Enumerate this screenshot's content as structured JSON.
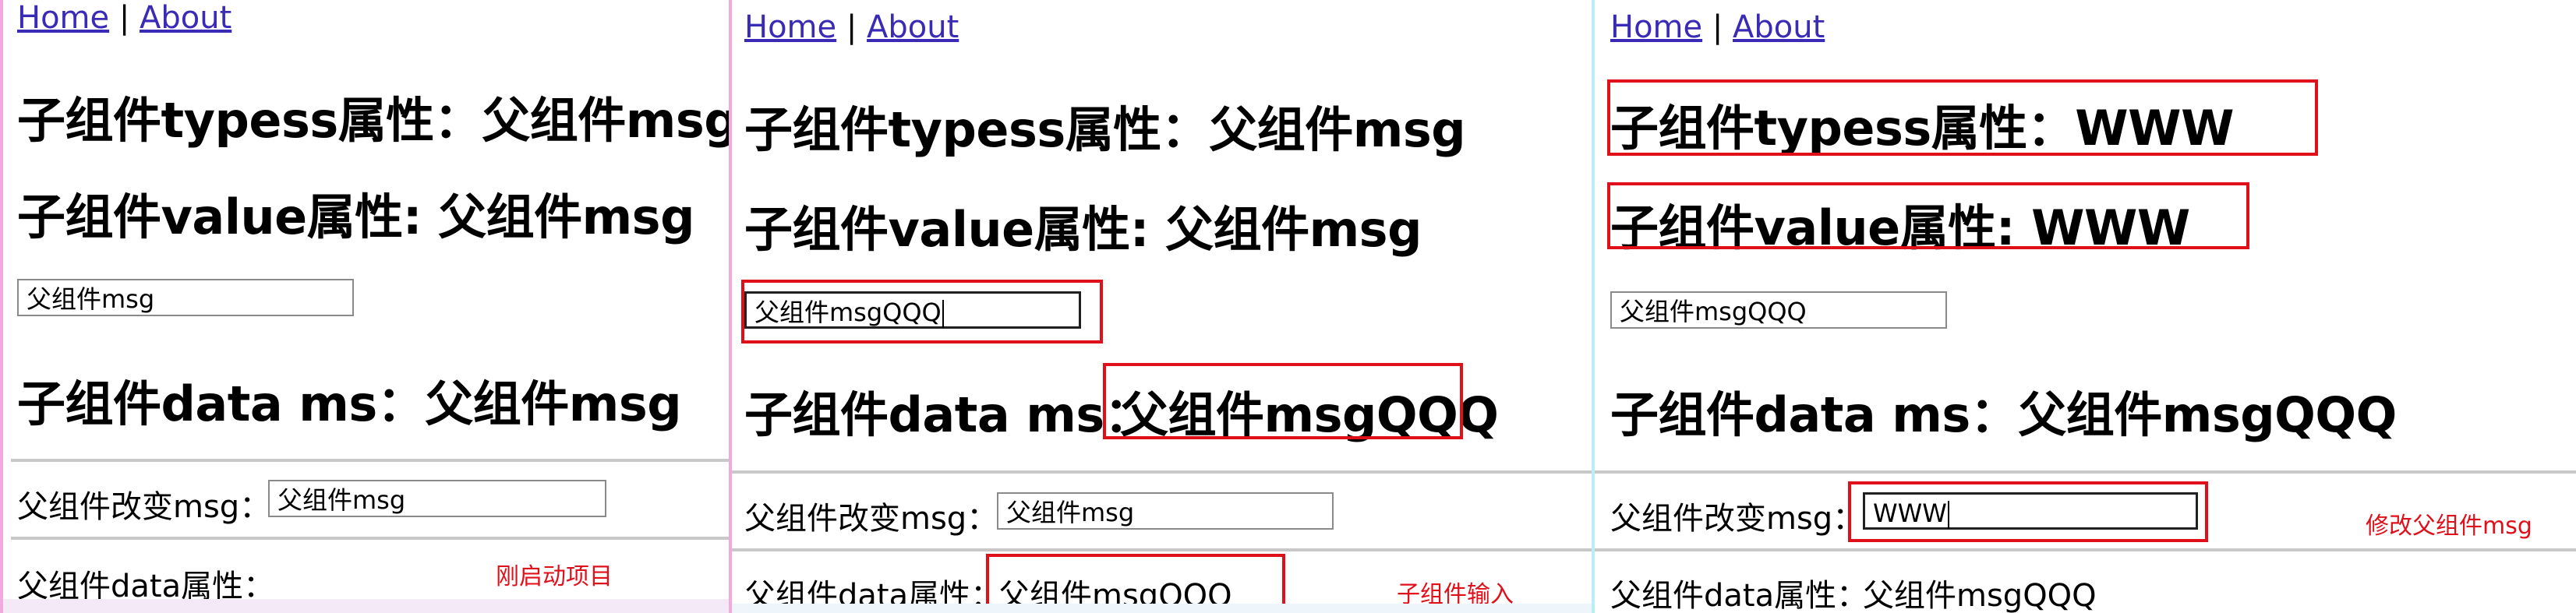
{
  "nav": {
    "home": "Home",
    "sep": "|",
    "about": "About"
  },
  "panels": [
    {
      "typess_line": "子组件typess属性：父组件msg",
      "value_line": "子组件value属性: 父组件msg",
      "child_input_value": "父组件msg",
      "data_ms_line": "子组件data ms：父组件msg",
      "parent_change_label": "父组件改变msg：",
      "parent_input_value": "父组件msg",
      "parent_data_label": "父组件data属性：",
      "parent_data_value": "",
      "note": "刚启动项目"
    },
    {
      "typess_line": "子组件typess属性：父组件msg",
      "value_line": "子组件value属性: 父组件msg",
      "child_input_value": "父组件msgQQQ",
      "data_ms_label": "子组件data ms：",
      "data_ms_value": "父组件msgQQQ",
      "parent_change_label": "父组件改变msg：",
      "parent_input_value": "父组件msg",
      "parent_data_label": "父组件data属性：",
      "parent_data_value": "父组件msgQQQ",
      "note": "子组件输入"
    },
    {
      "typess_line": "子组件typess属性：WWW",
      "value_line": "子组件value属性: WWW",
      "child_input_value": "父组件msgQQQ",
      "data_ms_line": "子组件data ms：父组件msgQQQ",
      "parent_change_label": "父组件改变msg：",
      "parent_input_value": "WWW",
      "parent_data_label": "父组件data属性：",
      "parent_data_value": "父组件msgQQQ",
      "note": "修改父组件msg"
    }
  ],
  "colors": {
    "annotation_red": "#e0101a",
    "link": "#3a2bb6"
  }
}
